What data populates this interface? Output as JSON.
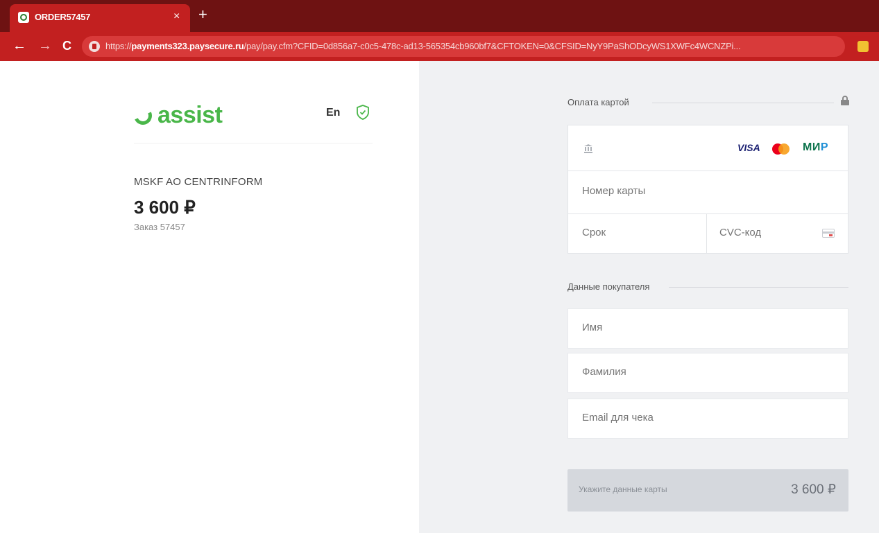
{
  "browser": {
    "tab_title": "ORDER57457",
    "tab_close": "×",
    "new_tab": "+",
    "back": "←",
    "forward": "→",
    "reload": "C",
    "url_prefix": "https://",
    "url_domain": "payments323.paysecure.ru",
    "url_rest": "/pay/pay.cfm?CFID=0d856a7-c0c5-478c-ad13-565354cb960bf7&CFTOKEN=0&CFSID=NyY9PaShODcyWS1XWFc4WCNZPi..."
  },
  "left": {
    "logo_text": "assist",
    "language": "En",
    "merchant": "MSKF AO CENTRINFORM",
    "amount": "3 600 ₽",
    "order": "Заказ 57457"
  },
  "card_section": {
    "title": "Оплата картой",
    "brands": {
      "visa": "VISA",
      "mir_main": "МИ",
      "mir_accent": "Р"
    },
    "card_number_placeholder": "Номер карты",
    "expiry_placeholder": "Срок",
    "cvc_placeholder": "CVC-код"
  },
  "buyer_section": {
    "title": "Данные покупателя",
    "first_name_placeholder": "Имя",
    "last_name_placeholder": "Фамилия",
    "email_placeholder": "Email для чека"
  },
  "pay_button": {
    "label": "Укажите данные карты",
    "amount": "3 600 ₽"
  },
  "colors": {
    "browser_tabbar": "#6e1212",
    "browser_toolbar": "#c22020",
    "brand_green": "#49b649",
    "right_pane_bg": "#f0f1f3"
  }
}
